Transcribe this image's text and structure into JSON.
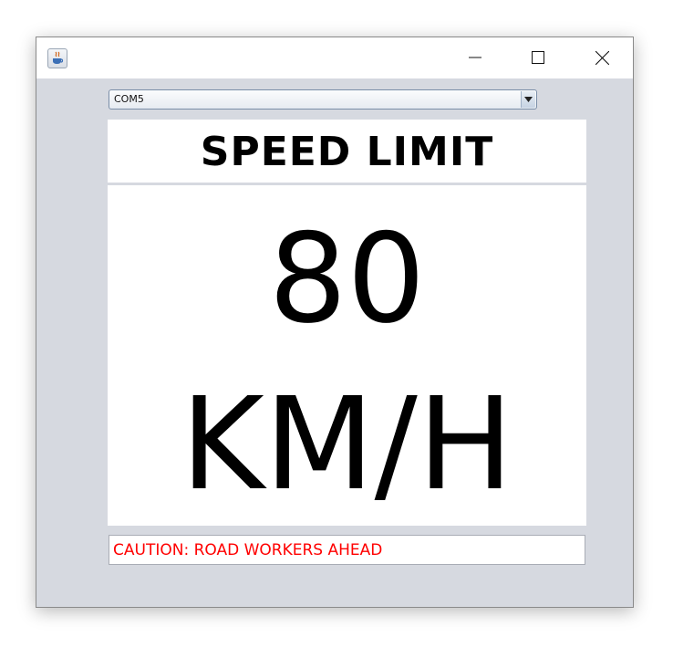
{
  "window": {
    "title": "",
    "controls": [
      "minimize-icon",
      "maximize-icon",
      "close-icon"
    ],
    "app_icon": "java-cup-icon"
  },
  "port_select": {
    "selected": "COM5",
    "arrow_icon": "triangle-down-icon"
  },
  "sign": {
    "heading": "SPEED LIMIT",
    "value": "80",
    "unit": "KM/H"
  },
  "message": {
    "text": "CAUTION: ROAD WORKERS AHEAD",
    "color": "#ff0000"
  },
  "colors": {
    "window_bg": "#d6d9e0",
    "panel_bg": "#ffffff"
  }
}
